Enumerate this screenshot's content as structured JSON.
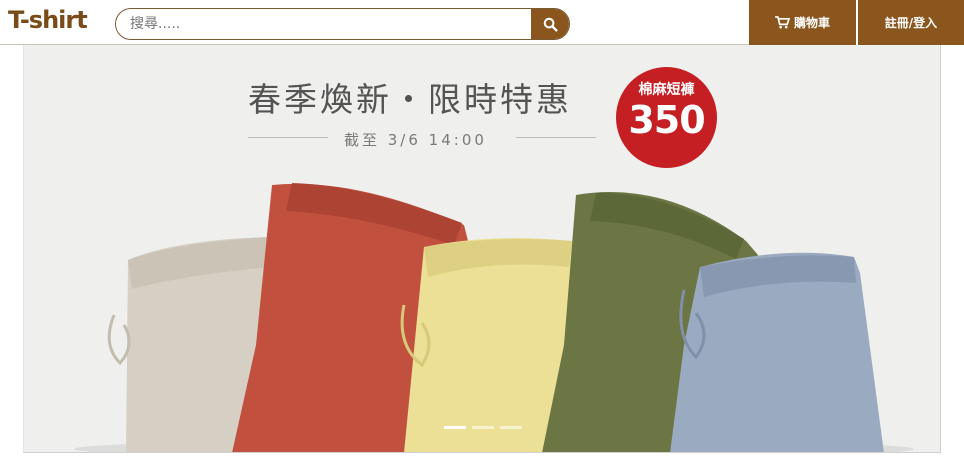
{
  "brand": {
    "logo_text": "T-shirt"
  },
  "search": {
    "placeholder": "搜尋....."
  },
  "nav": {
    "cart_label": "購物車",
    "login_label": "註冊/登入"
  },
  "banner": {
    "title": "春季煥新・限時特惠",
    "deadline": "截至 3/6 14:00",
    "promo_label": "棉麻短褲",
    "promo_price": "350",
    "slide_count": 3,
    "active_slide": 0
  },
  "colors": {
    "brand_brown": "#8a561e",
    "promo_red": "#c51e23",
    "pants": [
      "#d6d0c4",
      "#c1503f",
      "#ece096",
      "#6b7644",
      "#9aaac0"
    ]
  }
}
